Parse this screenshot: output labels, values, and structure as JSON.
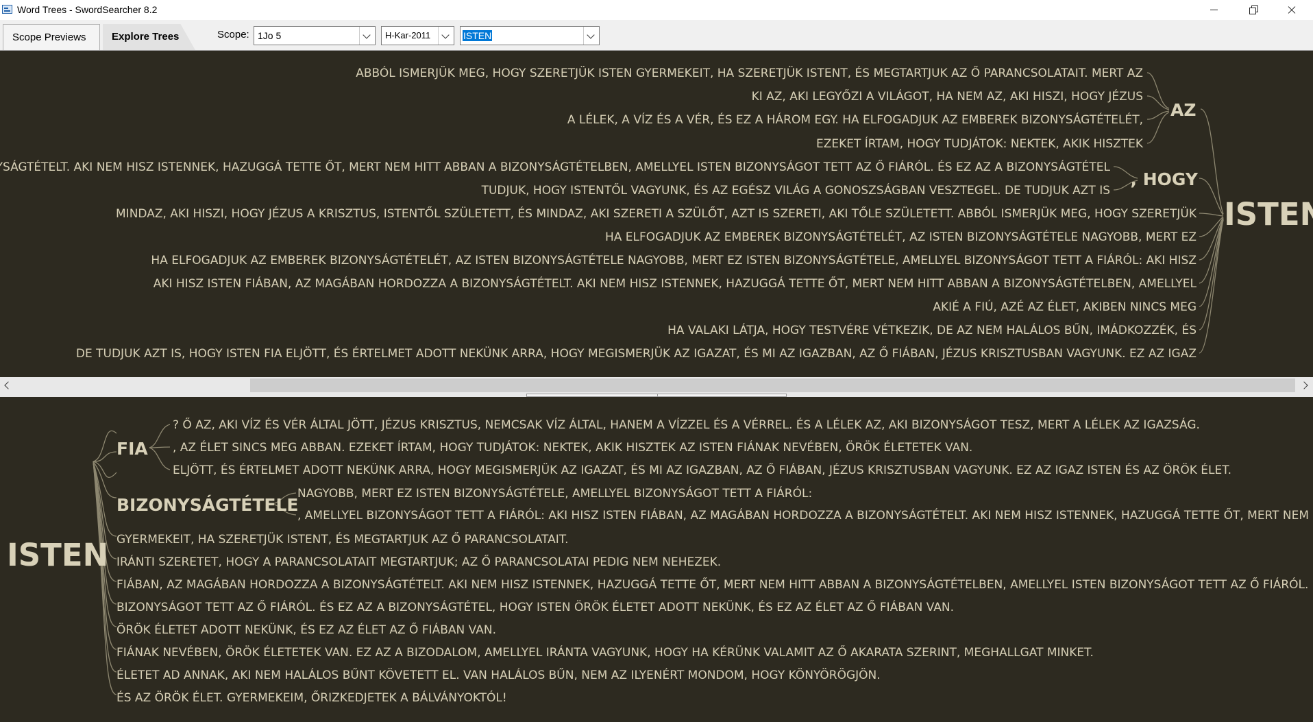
{
  "window": {
    "title": "Word Trees - SwordSearcher 8.2"
  },
  "tabs": [
    {
      "label": "Scope Previews"
    },
    {
      "label": "Explore Trees"
    }
  ],
  "toolbar": {
    "scope_label": "Scope:",
    "scope_value": "1Jo 5",
    "bible_value": "H-Kar-2011",
    "word_value": "ISTEN"
  },
  "top_tree": {
    "root": "ISTEN",
    "groups": [
      {
        "label": "AZ",
        "lines": [
          "ABBÓL ISMERJÜK MEG, HOGY SZERETJÜK ISTEN GYERMEKEIT, HA SZERETJÜK ISTENT, ÉS MEGTARTJUK AZ Ő PARANCSOLATAIT. MERT AZ",
          "KI AZ, AKI LEGYŐZI A VILÁGOT, HA NEM AZ, AKI HISZI, HOGY JÉZUS",
          "A LÉLEK, A VÍZ ÉS A VÉR, ÉS EZ A HÁROM EGY. HA ELFOGADJUK AZ EMBEREK BIZONYSÁGTÉTELÉT,",
          "EZEKET ÍRTAM, HOGY TUDJÁTOK: NEKTEK, AKIK HISZTEK"
        ]
      },
      {
        "label": ", HOGY",
        "lines": [
          "A BIZONYSÁGTÉTELT. AKI NEM HISZ ISTENNEK, HAZUGGÁ TETTE ŐT, MERT NEM HITT ABBAN A BIZONYSÁGTÉTELBEN, AMELLYEL ISTEN BIZONYSÁGOT TETT AZ Ő FIÁRÓL. ÉS EZ AZ A BIZONYSÁGTÉTEL",
          "TUDJUK, HOGY ISTENTŐL VAGYUNK, ÉS AZ EGÉSZ VILÁG A GONOSZSÁGBAN VESZTEGEL. DE TUDJUK AZT IS"
        ]
      }
    ],
    "direct": [
      "MINDAZ, AKI HISZI, HOGY JÉZUS A KRISZTUS, ISTENTŐL SZÜLETETT, ÉS MINDAZ, AKI SZERETI A SZÜLŐT, AZT IS SZERETI, AKI TŐLE SZÜLETETT. ABBÓL ISMERJÜK MEG, HOGY SZERETJÜK",
      "HA ELFOGADJUK AZ EMBEREK BIZONYSÁGTÉTELÉT, AZ ISTEN BIZONYSÁGTÉTELE NAGYOBB, MERT EZ",
      "HA ELFOGADJUK AZ EMBEREK BIZONYSÁGTÉTELÉT, AZ ISTEN BIZONYSÁGTÉTELE NAGYOBB, MERT EZ ISTEN BIZONYSÁGTÉTELE, AMELLYEL BIZONYSÁGOT TETT A FIÁRÓL: AKI HISZ",
      "AKI HISZ ISTEN FIÁBAN, AZ MAGÁBAN HORDOZZA A BIZONYSÁGTÉTELT. AKI NEM HISZ ISTENNEK, HAZUGGÁ TETTE ŐT, MERT NEM HITT ABBAN A BIZONYSÁGTÉTELBEN, AMELLYEL",
      "AKIÉ A FIÚ, AZÉ AZ ÉLET, AKIBEN NINCS MEG",
      "HA VALAKI LÁTJA, HOGY TESTVÉRE VÉTKEZIK, DE AZ NEM HALÁLOS BŰN, IMÁDKOZZÉK, ÉS",
      "DE TUDJUK AZT IS, HOGY ISTEN FIA ELJÖTT, ÉS ÉRTELMET ADOTT NEKÜNK ARRA, HOGY MEGISMERJÜK AZ IGAZAT, ÉS MI AZ IGAZBAN, AZ Ő FIÁBAN, JÉZUS KRISZTUSBAN VAGYUNK. EZ AZ IGAZ"
    ]
  },
  "bottom_tree": {
    "root": "ISTEN",
    "groups": [
      {
        "label": "FIA",
        "lines": [
          "? Ő AZ, AKI VÍZ ÉS VÉR ÁLTAL JÖTT, JÉZUS KRISZTUS, NEMCSAK VÍZ ÁLTAL, HANEM A VÍZZEL ÉS A VÉRREL. ÉS A LÉLEK AZ, AKI BIZONYSÁGOT TESZ, MERT A LÉLEK AZ IGAZSÁG.",
          ", AZ ÉLET SINCS MEG ABBAN. EZEKET ÍRTAM, HOGY TUDJÁTOK: NEKTEK, AKIK HISZTEK AZ ISTEN FIÁNAK NEVÉBEN, ÖRÖK ÉLETETEK VAN.",
          "ELJÖTT, ÉS ÉRTELMET ADOTT NEKÜNK ARRA, HOGY MEGISMERJÜK AZ IGAZAT, ÉS MI AZ IGAZBAN, AZ Ő FIÁBAN, JÉZUS KRISZTUSBAN VAGYUNK. EZ AZ IGAZ ISTEN ÉS AZ ÖRÖK ÉLET."
        ]
      },
      {
        "label": "BIZONYSÁGTÉTELE",
        "lines": [
          "NAGYOBB, MERT EZ ISTEN BIZONYSÁGTÉTELE, AMELLYEL BIZONYSÁGOT TETT A FIÁRÓL:",
          ", AMELLYEL BIZONYSÁGOT TETT A FIÁRÓL: AKI HISZ ISTEN FIÁBAN, AZ MAGÁBAN HORDOZZA A BIZONYSÁGTÉTELT. AKI NEM HISZ ISTENNEK, HAZUGGÁ TETTE ŐT, MERT NEM HITT ABBAN A BIZONYSÁGTÉTELBEN"
        ]
      }
    ],
    "direct": [
      "GYERMEKEIT, HA SZERETJÜK ISTENT, ÉS MEGTARTJUK AZ Ő PARANCSOLATAIT.",
      "IRÁNTI SZERETET, HOGY A PARANCSOLATAIT MEGTARTJUK; AZ Ő PARANCSOLATAI PEDIG NEM NEHEZEK.",
      "FIÁBAN, AZ MAGÁBAN HORDOZZA A BIZONYSÁGTÉTELT. AKI NEM HISZ ISTENNEK, HAZUGGÁ TETTE ŐT, MERT NEM HITT ABBAN A BIZONYSÁGTÉTELBEN, AMELLYEL ISTEN BIZONYSÁGOT TETT AZ Ő FIÁRÓL.",
      "BIZONYSÁGOT TETT AZ Ő FIÁRÓL. ÉS EZ AZ A BIZONYSÁGTÉTEL, HOGY ISTEN ÖRÖK ÉLETET ADOTT NEKÜNK, ÉS EZ AZ ÉLET AZ Ő FIÁBAN VAN.",
      "ÖRÖK ÉLETET ADOTT NEKÜNK, ÉS EZ AZ ÉLET AZ Ő FIÁBAN VAN.",
      "FIÁNAK NEVÉBEN, ÖRÖK ÉLETETEK VAN. EZ AZ A BIZODALOM, AMELLYEL IRÁNTA VAGYUNK, HOGY HA KÉRÜNK VALAMIT AZ Ő AKARATA SZERINT, MEGHALLGAT MINKET.",
      "ÉLETET AD ANNAK, AKI NEM HALÁLOS BŰNT KÖVETETT EL. VAN HALÁLOS BŰN, NEM AZ ILYENÉRT MONDOM, HOGY KÖNYÖRÖGJÖN.",
      "ÉS AZ ÖRÖK ÉLET. GYERMEKEIM, ŐRIZKEDJETEK A BÁLVÁNYOKTÓL!"
    ]
  }
}
